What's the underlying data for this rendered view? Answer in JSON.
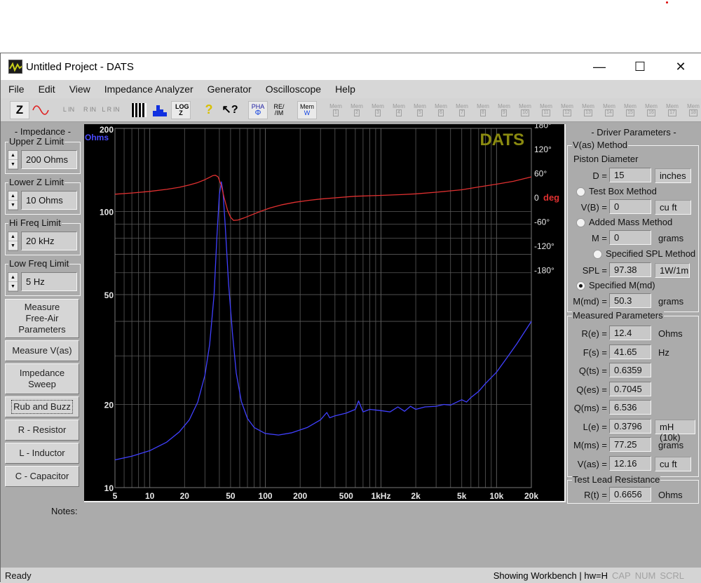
{
  "window": {
    "title": "Untitled Project - DATS",
    "controls": {
      "minimize": "—",
      "maximize": "☐",
      "close": "✕"
    }
  },
  "menu": [
    "File",
    "Edit",
    "View",
    "Impedance Analyzer",
    "Generator",
    "Oscilloscope",
    "Help"
  ],
  "toolbar": {
    "buttons": [
      {
        "id": "impedance-mode",
        "label": "Z",
        "pressed": true
      },
      {
        "id": "generator-wave",
        "label": "∿",
        "pressed": false
      },
      {
        "id": "left-in",
        "label": "L IN",
        "disabled": true
      },
      {
        "id": "right-in",
        "label": "R IN",
        "disabled": true
      },
      {
        "id": "lr-in",
        "label": "L R IN",
        "disabled": true
      },
      {
        "id": "piano",
        "label": "piano"
      },
      {
        "id": "bar-chart",
        "label": "bars"
      },
      {
        "id": "log-z",
        "label": "LOG Z",
        "pressed": true
      },
      {
        "id": "help",
        "label": "?"
      },
      {
        "id": "context-help",
        "label": "↖?"
      },
      {
        "id": "phase",
        "label_top": "PHA",
        "label_bottom": "Φ",
        "pressed": true
      },
      {
        "id": "re-im",
        "label_top": "RE/",
        "label_bottom": "/IM"
      },
      {
        "id": "mem-w",
        "label_top": "Mem",
        "label_bottom": "W",
        "pressed": true
      }
    ],
    "mem_label": "Mem",
    "mem_slots": [
      "1",
      "2",
      "3",
      "4",
      "5",
      "6",
      "7",
      "8",
      "9",
      "10",
      "11",
      "12",
      "13",
      "14",
      "15",
      "16",
      "17",
      "18"
    ]
  },
  "left_panel": {
    "heading": "- Impedance -",
    "limits": [
      {
        "label": "Upper Z Limit",
        "value": "200 Ohms"
      },
      {
        "label": "Lower Z Limit",
        "value": "10 Ohms"
      },
      {
        "label": "Hi Freq Limit",
        "value": "20 kHz"
      },
      {
        "label": "Low Freq Limit",
        "value": "5 Hz"
      }
    ],
    "buttons": [
      "Measure Free-Air Parameters",
      "Measure V(as)",
      "Impedance Sweep",
      "Rub and Buzz",
      "R - Resistor",
      "L - Inductor",
      "C - Capacitor"
    ],
    "notes_label": "Notes:"
  },
  "right_panel": {
    "heading": "- Driver Parameters -",
    "vas_method": {
      "title": "V(as) Method",
      "piston_label": "Piston Diameter",
      "d_label": "D =",
      "d_value": "15",
      "d_unit": "inches",
      "test_box_label": "Test Box Method",
      "test_box_selected": false,
      "vb_label": "V(B) =",
      "vb_value": "0",
      "vb_unit": "cu ft",
      "added_mass_label": "Added Mass Method",
      "added_mass_selected": false,
      "m_label": "M =",
      "m_value": "0",
      "m_unit": "grams",
      "spl_method_label": "Specified SPL Method",
      "spl_method_selected": false,
      "spl_label": "SPL =",
      "spl_value": "97.38",
      "spl_unit": "1W/1m",
      "mmd_method_label": "Specified M(md)",
      "mmd_method_selected": true,
      "mmd_label": "M(md) =",
      "mmd_value": "50.3",
      "mmd_unit": "grams"
    },
    "measured": {
      "title": "Measured Parameters",
      "rows": [
        {
          "label": "R(e) =",
          "value": "12.4",
          "unit": "Ohms",
          "unit_boxed": false
        },
        {
          "label": "F(s) =",
          "value": "41.65",
          "unit": "Hz",
          "unit_boxed": false
        },
        {
          "label": "Q(ts) =",
          "value": "0.6359",
          "unit": "",
          "unit_boxed": false
        },
        {
          "label": "Q(es) =",
          "value": "0.7045",
          "unit": "",
          "unit_boxed": false
        },
        {
          "label": "Q(ms) =",
          "value": "6.536",
          "unit": "",
          "unit_boxed": false
        },
        {
          "label": "L(e) =",
          "value": "0.3796",
          "unit": "mH (10k)",
          "unit_boxed": true
        },
        {
          "label": "M(ms) =",
          "value": "77.25",
          "unit": "grams",
          "unit_boxed": false
        },
        {
          "label": "V(as) =",
          "value": "12.16",
          "unit": "cu ft",
          "unit_boxed": true
        }
      ]
    },
    "test_lead": {
      "title": "Test Lead Resistance",
      "label": "R(t) =",
      "value": "0.6656",
      "unit": "Ohms"
    }
  },
  "status": {
    "left": "Ready",
    "workbench": "Showing Workbench | hw=H",
    "indicators": [
      "CAP",
      "NUM",
      "SCRL"
    ]
  },
  "colors": {
    "impedance": "#4040ff",
    "phase": "#e03030",
    "grid": "#5a5a5a",
    "watermark": "#8a8a10",
    "axis_text": "#e8e8e8"
  },
  "chart_data": {
    "type": "line",
    "watermark": "DATS",
    "x_scale": "log",
    "xlim": [
      5,
      20000
    ],
    "x_ticks": [
      {
        "v": 5,
        "label": "5"
      },
      {
        "v": 10,
        "label": "10"
      },
      {
        "v": 20,
        "label": "20"
      },
      {
        "v": 50,
        "label": "50"
      },
      {
        "v": 100,
        "label": "100"
      },
      {
        "v": 200,
        "label": "200"
      },
      {
        "v": 500,
        "label": "500"
      },
      {
        "v": 1000,
        "label": "1kHz"
      },
      {
        "v": 2000,
        "label": "2k"
      },
      {
        "v": 5000,
        "label": "5k"
      },
      {
        "v": 10000,
        "label": "10k"
      },
      {
        "v": 20000,
        "label": "20k"
      }
    ],
    "y_left": {
      "unit_label": "Ohms",
      "scale": "log",
      "lim": [
        10,
        200
      ],
      "ticks": [
        {
          "v": 200,
          "label": "200"
        },
        {
          "v": 100,
          "label": "100"
        },
        {
          "v": 50,
          "label": "50"
        },
        {
          "v": 20,
          "label": "20"
        },
        {
          "v": 10,
          "label": "10"
        }
      ]
    },
    "y_right": {
      "unit_label": "deg",
      "lim": [
        -180,
        180
      ],
      "ticks": [
        {
          "v": 180,
          "label": "180°"
        },
        {
          "v": 120,
          "label": "120°"
        },
        {
          "v": 60,
          "label": "60°"
        },
        {
          "v": 0,
          "label": "0"
        },
        {
          "v": -60,
          "label": "-60°"
        },
        {
          "v": -120,
          "label": "-120°"
        },
        {
          "v": -180,
          "label": "-180°"
        }
      ]
    },
    "grid": true,
    "series": [
      {
        "name": "Impedance",
        "axis": "left",
        "x": [
          5,
          7,
          10,
          14,
          18,
          22,
          26,
          30,
          33,
          36,
          38,
          40,
          41.65,
          43,
          45,
          48,
          52,
          56,
          62,
          70,
          80,
          100,
          130,
          170,
          230,
          300,
          340,
          360,
          400,
          500,
          600,
          640,
          700,
          800,
          1000,
          1200,
          1400,
          1600,
          1800,
          2000,
          2400,
          3000,
          3500,
          4000,
          5000,
          5500,
          6000,
          7000,
          8000,
          10000,
          12500,
          15000,
          20000
        ],
        "y": [
          12.6,
          13.0,
          13.6,
          14.6,
          15.9,
          17.6,
          20.4,
          25.5,
          33,
          50,
          80,
          115,
          128,
          118,
          88,
          55,
          36,
          26,
          20.5,
          17.8,
          16.5,
          15.7,
          15.5,
          15.8,
          16.5,
          17.6,
          18.7,
          17.9,
          18.2,
          18.6,
          19.2,
          20.6,
          18.8,
          19.2,
          19.0,
          18.8,
          19.6,
          18.9,
          19.7,
          19.2,
          19.6,
          19.7,
          20.0,
          19.9,
          20.8,
          20.4,
          21.2,
          22.3,
          23.8,
          26.2,
          29.8,
          33.2,
          40
        ]
      },
      {
        "name": "Phase",
        "axis": "right",
        "x": [
          5,
          7,
          10,
          14,
          18,
          22,
          26,
          30,
          33,
          35,
          37,
          39,
          41.65,
          44,
          47,
          50,
          53,
          58,
          65,
          75,
          90,
          110,
          140,
          180,
          240,
          300,
          400,
          600,
          1000,
          1500,
          2000,
          3000,
          5000,
          7000,
          10000,
          14000,
          20000
        ],
        "y": [
          9,
          12,
          16,
          21,
          26,
          32,
          38,
          45,
          51,
          55,
          56,
          52,
          30,
          0,
          -30,
          -48,
          -56,
          -55,
          -50,
          -43,
          -34,
          -25,
          -17,
          -11,
          -6,
          -3,
          0,
          4,
          6,
          8,
          10,
          14,
          20,
          27,
          34,
          41,
          52
        ]
      }
    ]
  }
}
